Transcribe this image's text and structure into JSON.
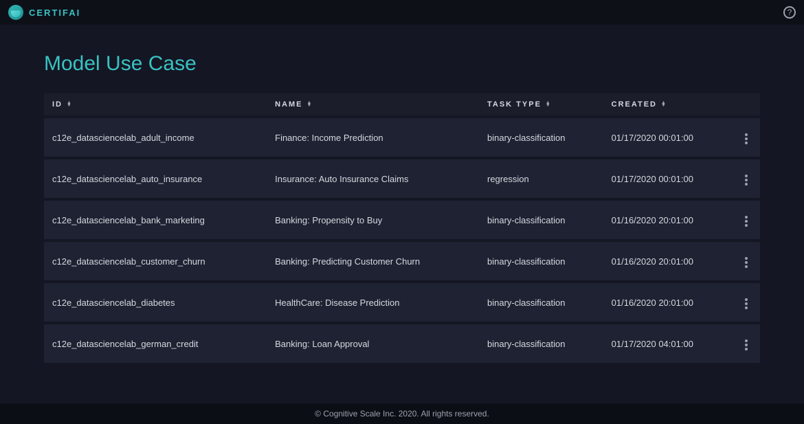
{
  "app": {
    "brand": "CERTIFAI"
  },
  "help": {
    "glyph": "?"
  },
  "page": {
    "title": "Model Use Case"
  },
  "columns": {
    "id": {
      "label": "ID"
    },
    "name": {
      "label": "NAME"
    },
    "task": {
      "label": "TASK TYPE"
    },
    "created": {
      "label": "CREATED"
    }
  },
  "rows": [
    {
      "id": "c12e_datasciencelab_adult_income",
      "name": "Finance: Income Prediction",
      "task": "binary-classification",
      "created": "01/17/2020 00:01:00"
    },
    {
      "id": "c12e_datasciencelab_auto_insurance",
      "name": "Insurance: Auto Insurance Claims",
      "task": "regression",
      "created": "01/17/2020 00:01:00"
    },
    {
      "id": "c12e_datasciencelab_bank_marketing",
      "name": "Banking: Propensity to Buy",
      "task": "binary-classification",
      "created": "01/16/2020 20:01:00"
    },
    {
      "id": "c12e_datasciencelab_customer_churn",
      "name": "Banking: Predicting Customer Churn",
      "task": "binary-classification",
      "created": "01/16/2020 20:01:00"
    },
    {
      "id": "c12e_datasciencelab_diabetes",
      "name": "HealthCare: Disease Prediction",
      "task": "binary-classification",
      "created": "01/16/2020 20:01:00"
    },
    {
      "id": "c12e_datasciencelab_german_credit",
      "name": "Banking: Loan Approval",
      "task": "binary-classification",
      "created": "01/17/2020 04:01:00"
    }
  ],
  "footer": {
    "text": "© Cognitive Scale Inc. 2020. All rights reserved."
  }
}
